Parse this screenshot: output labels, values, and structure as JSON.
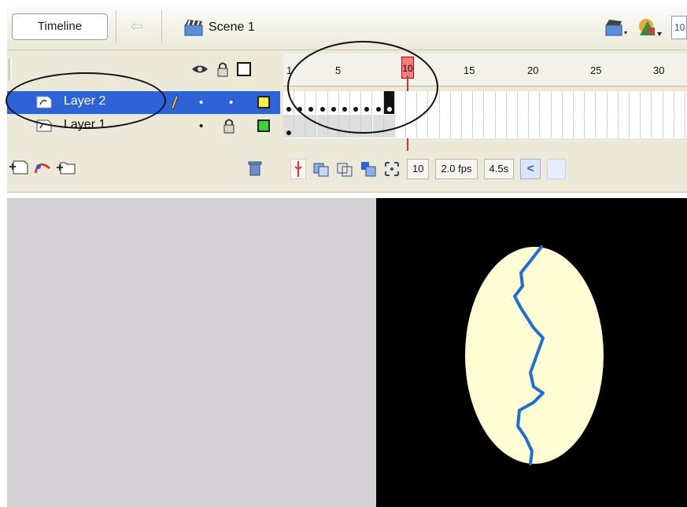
{
  "toolbar": {
    "timeline_label": "Timeline",
    "back_icon": "arrow-left-icon",
    "scene_label": "Scene 1",
    "zoom_value": "10"
  },
  "timeline": {
    "header_icons": [
      "eye-icon",
      "lock-icon",
      "outline-icon"
    ],
    "ruler_ticks": [
      "1",
      "5",
      "10",
      "15",
      "20",
      "25",
      "30"
    ],
    "current_frame_marker": "10",
    "layers": [
      {
        "name": "Layer 2",
        "selected": true,
        "outline_color": "#f5f04a"
      },
      {
        "name": "Layer 1",
        "selected": false,
        "outline_color": "#3bd13b"
      }
    ],
    "controls": {
      "current_frame": "10",
      "frame_rate": "2.0 fps",
      "elapsed_time": "4.5s"
    }
  },
  "stage": {
    "background_color": "#000000",
    "shape_fill": "#fdfcd3",
    "stroke_color": "#1f6fd1"
  }
}
